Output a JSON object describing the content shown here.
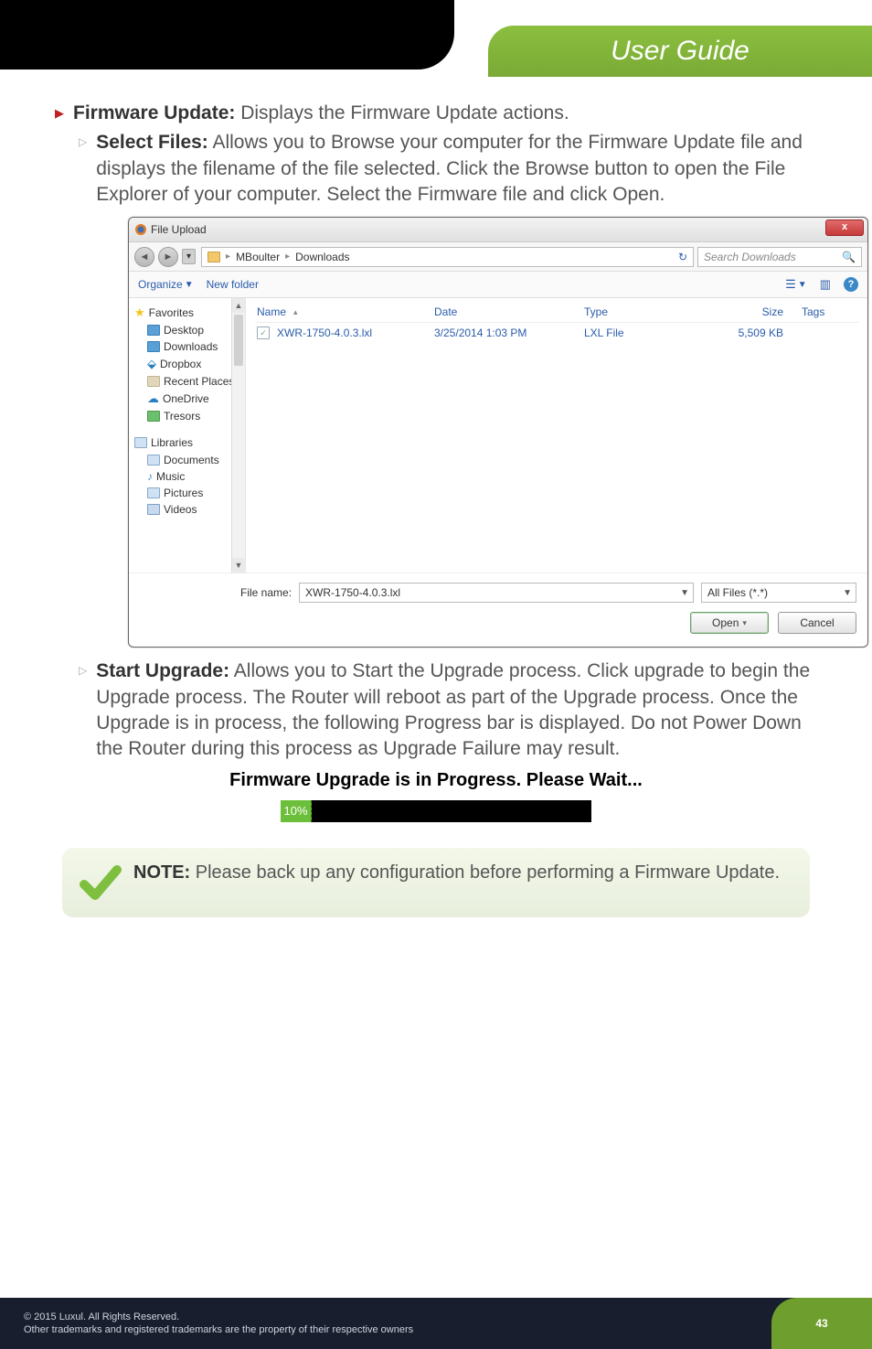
{
  "header": {
    "title": "User Guide"
  },
  "body": {
    "firmware_update_label": "Firmware Update:",
    "firmware_update_desc": " Displays the Firmware Update actions.",
    "select_files_label": "Select Files:",
    "select_files_desc": " Allows you to Browse your computer for the Firmware Update file and displays the filename of the file selected. Click the Browse button to open the File Explorer of your computer. Select the Firmware file and click Open.",
    "start_upgrade_label": "Start Upgrade:",
    "start_upgrade_desc": " Allows you to Start the Upgrade process. Click upgrade to begin the Upgrade process. The Router will reboot as part of the Upgrade process. Once the Upgrade is in process, the following Progress bar is displayed. Do not Power Down the Router during this process as Upgrade Failure may result.",
    "progress_title": "Firmware Upgrade is in Progress. Please Wait...",
    "progress_percent": "10%",
    "note_label": "NOTE:",
    "note_text": " Please back up any configuration before performing a Firmware Update."
  },
  "dialog": {
    "title": "File Upload",
    "breadcrumb": {
      "root": "MBoulter",
      "folder": "Downloads"
    },
    "search_placeholder": "Search Downloads",
    "toolbar": {
      "organize": "Organize",
      "new_folder": "New folder"
    },
    "columns": {
      "name": "Name",
      "date": "Date",
      "type": "Type",
      "size": "Size",
      "tags": "Tags"
    },
    "rows": [
      {
        "name": "XWR-1750-4.0.3.lxl",
        "date": "3/25/2014 1:03 PM",
        "type": "LXL File",
        "size": "5,509 KB",
        "tags": ""
      }
    ],
    "sidebar": {
      "favorites": "Favorites",
      "items_fav": [
        "Desktop",
        "Downloads",
        "Dropbox",
        "Recent Places",
        "OneDrive",
        "Tresors"
      ],
      "libraries": "Libraries",
      "items_lib": [
        "Documents",
        "Music",
        "Pictures",
        "Videos"
      ]
    },
    "file_name_label": "File name:",
    "file_name_value": "XWR-1750-4.0.3.lxl",
    "file_filter": "All Files (*.*)",
    "open_btn": "Open",
    "cancel_btn": "Cancel"
  },
  "footer": {
    "line1": "© 2015  Luxul. All Rights Reserved.",
    "line2": "Other trademarks and registered trademarks are the property of their respective owners",
    "page_number": "43"
  }
}
